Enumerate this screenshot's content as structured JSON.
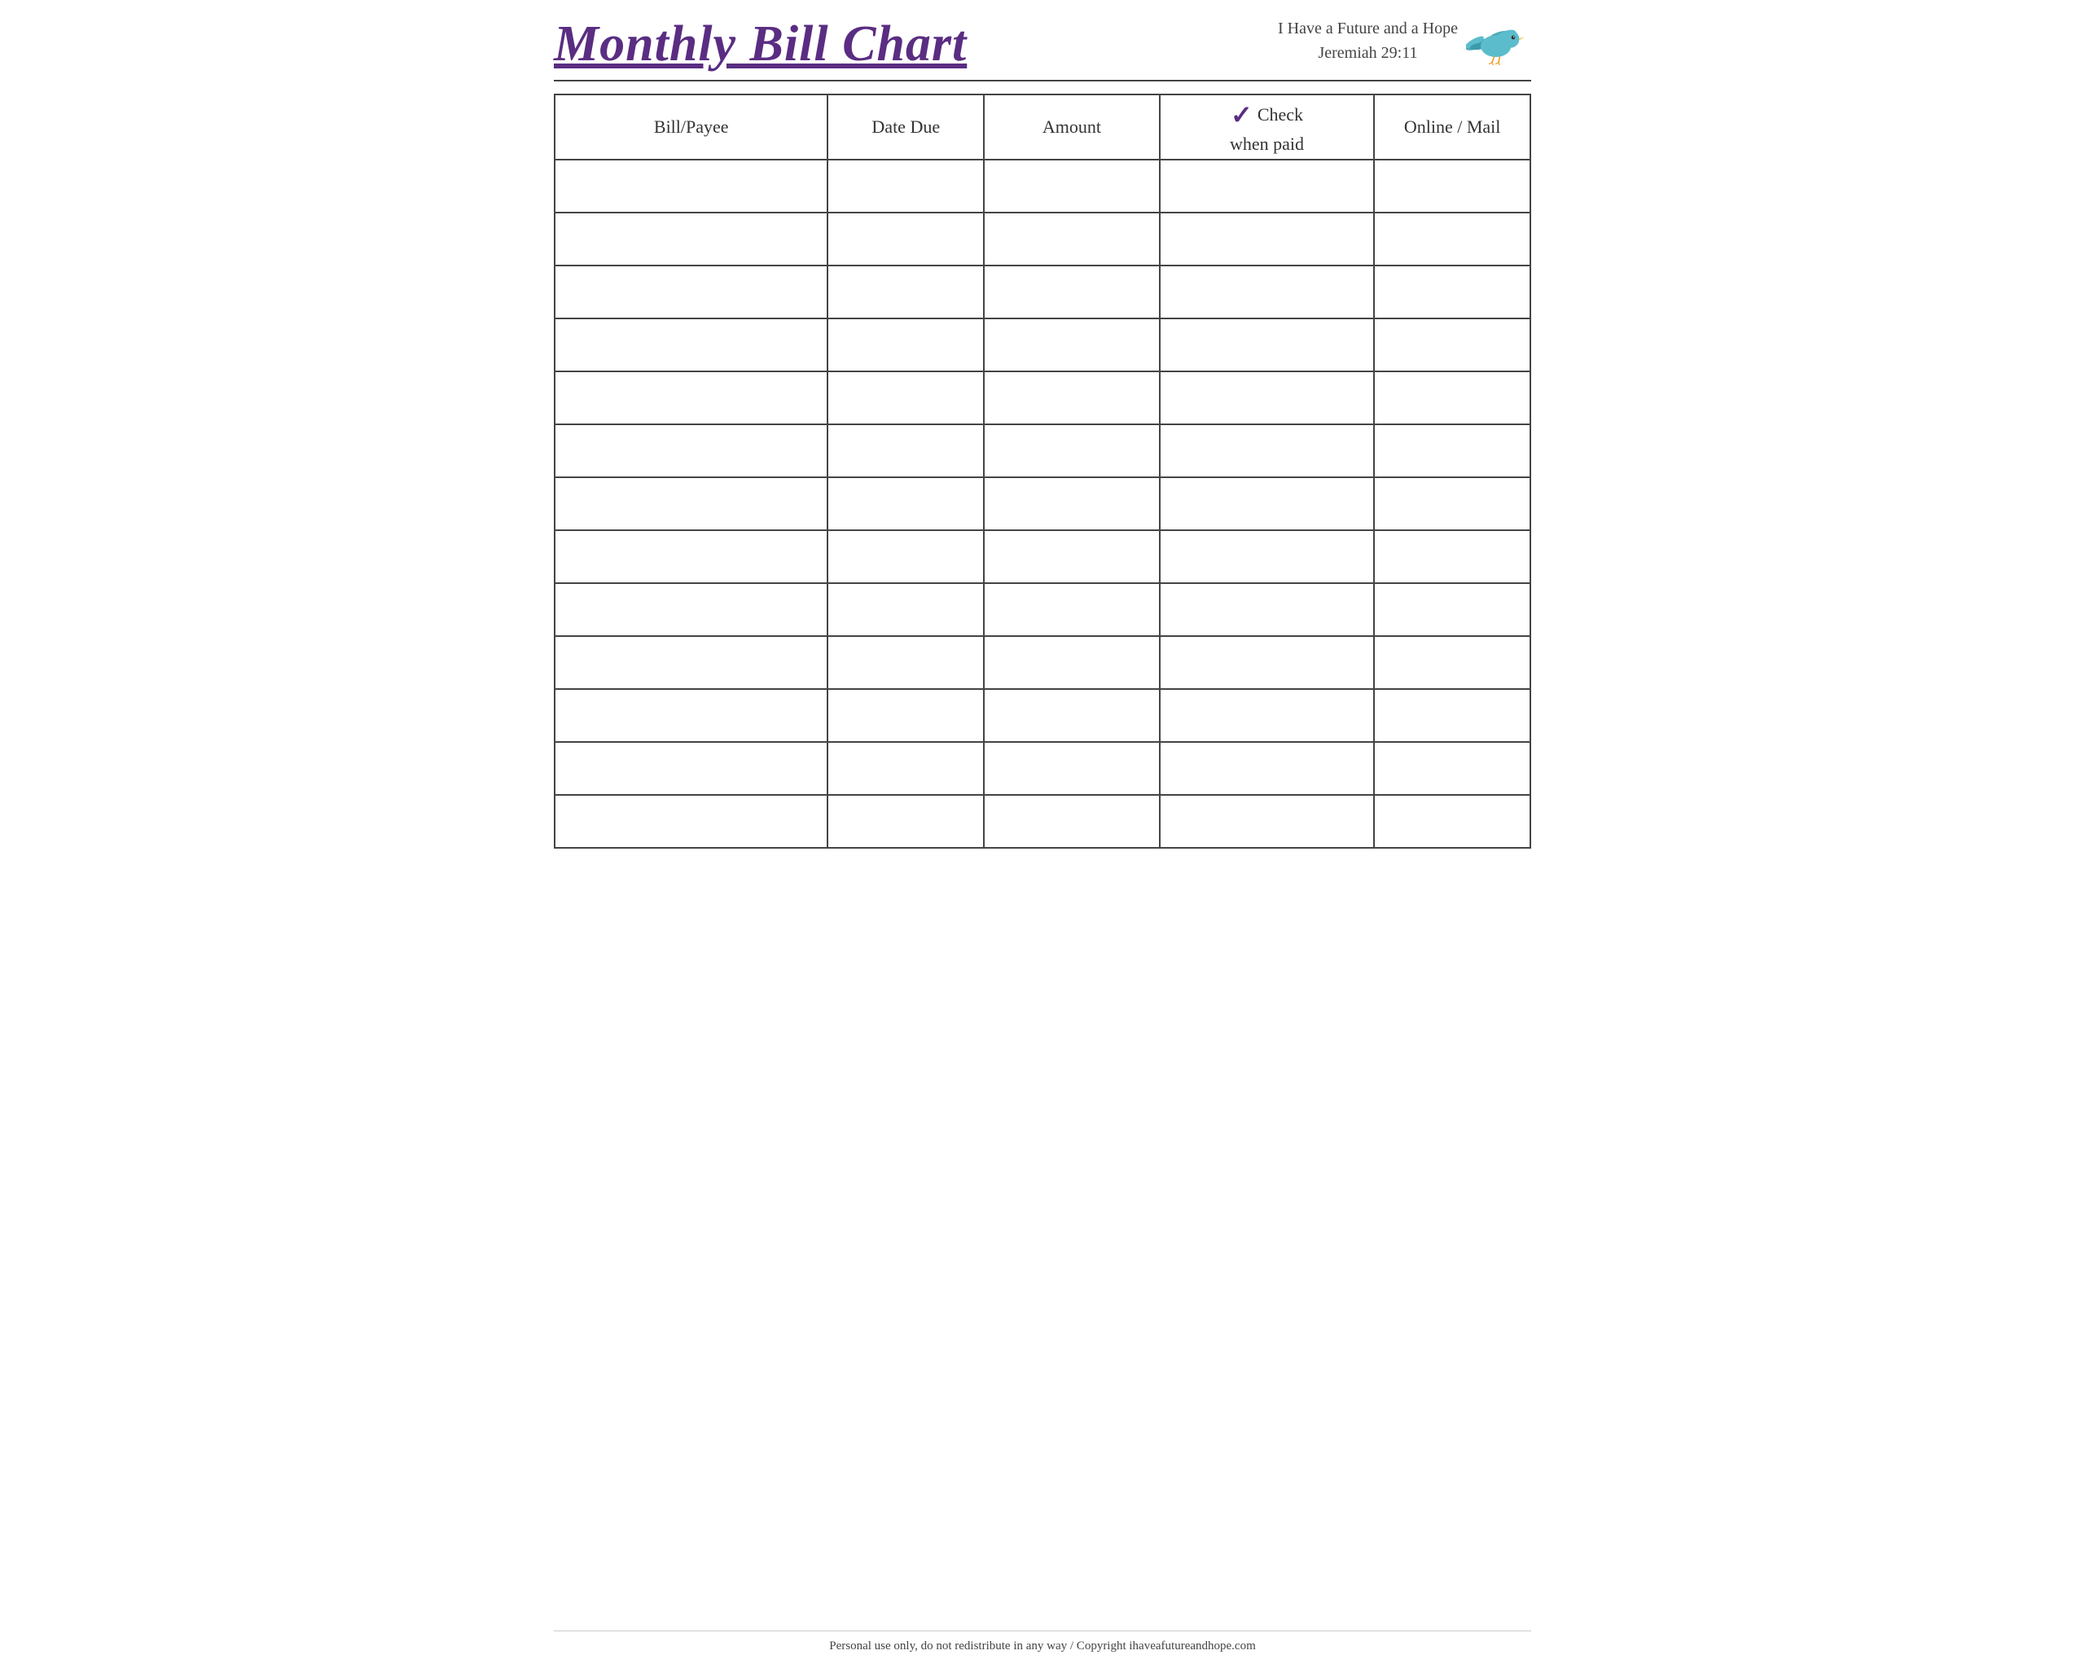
{
  "header": {
    "title": "Monthly Bill Chart",
    "subtitle_line1": "I Have a Future and a Hope",
    "subtitle_line2": "Jeremiah 29:11"
  },
  "table": {
    "columns": [
      {
        "id": "bill-payee",
        "label": "Bill/Payee"
      },
      {
        "id": "date-due",
        "label": "Date Due"
      },
      {
        "id": "amount",
        "label": "Amount"
      },
      {
        "id": "check-when-paid",
        "label_top": "Check",
        "label_bottom": "when paid",
        "has_checkmark": true
      },
      {
        "id": "online-mail",
        "label": "Online / Mail"
      }
    ],
    "row_count": 13
  },
  "footer": {
    "text": "Personal use only, do not redistribute in any way / Copyright ihaveafutureandhope.com"
  }
}
